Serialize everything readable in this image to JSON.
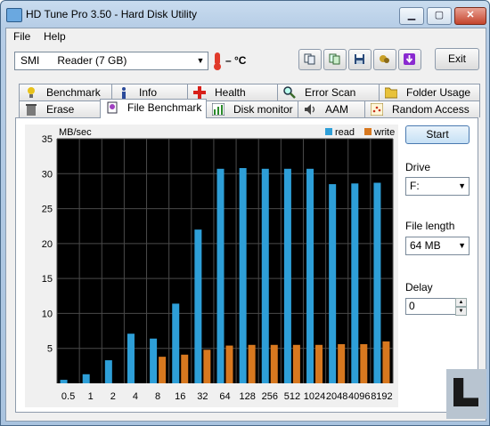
{
  "window": {
    "title": "HD Tune Pro 3.50 - Hard Disk Utility",
    "min_label": "▁",
    "max_label": "▢",
    "close_label": "✕"
  },
  "menu": {
    "file": "File",
    "help": "Help"
  },
  "toolbar": {
    "drive_name": "SMI      Reader (7 GB)",
    "temperature": "– °C",
    "exit_label": "Exit",
    "buttons": [
      "copy-info-icon",
      "copy-screenshot-icon",
      "save-icon",
      "options-icon",
      "download-icon"
    ]
  },
  "tabs": {
    "row1": [
      "Benchmark",
      "Info",
      "Health",
      "Error Scan",
      "Folder Usage"
    ],
    "row2": [
      "Erase",
      "File Benchmark",
      "Disk monitor",
      "AAM",
      "Random Access"
    ],
    "active": "File Benchmark"
  },
  "controls": {
    "start_label": "Start",
    "drive_label": "Drive",
    "drive_value": "F:",
    "file_length_label": "File length",
    "file_length_value": "64 MB",
    "delay_label": "Delay",
    "delay_value": "0"
  },
  "colors": {
    "read": "#2e9fd8",
    "write": "#d7781f",
    "plot_bg": "#000000"
  },
  "chart_data": {
    "type": "bar",
    "ylabel": "MB/sec",
    "ylim": [
      0,
      35
    ],
    "yticks": [
      5,
      10,
      15,
      20,
      25,
      30,
      35
    ],
    "categories": [
      "0.5",
      "1",
      "2",
      "4",
      "8",
      "16",
      "32",
      "64",
      "128",
      "256",
      "512",
      "1024",
      "2048",
      "4096",
      "8192"
    ],
    "series": [
      {
        "name": "read",
        "values": [
          0.5,
          1.3,
          3.3,
          7.1,
          6.4,
          11.4,
          22.0,
          30.7,
          30.8,
          30.7,
          30.7,
          30.7,
          28.5,
          28.6,
          28.7
        ]
      },
      {
        "name": "write",
        "values": [
          0,
          0,
          0,
          0,
          3.8,
          4.1,
          4.8,
          5.4,
          5.5,
          5.5,
          5.5,
          5.5,
          5.6,
          5.6,
          6.0
        ]
      }
    ],
    "legend": "top-right",
    "grid": true
  }
}
